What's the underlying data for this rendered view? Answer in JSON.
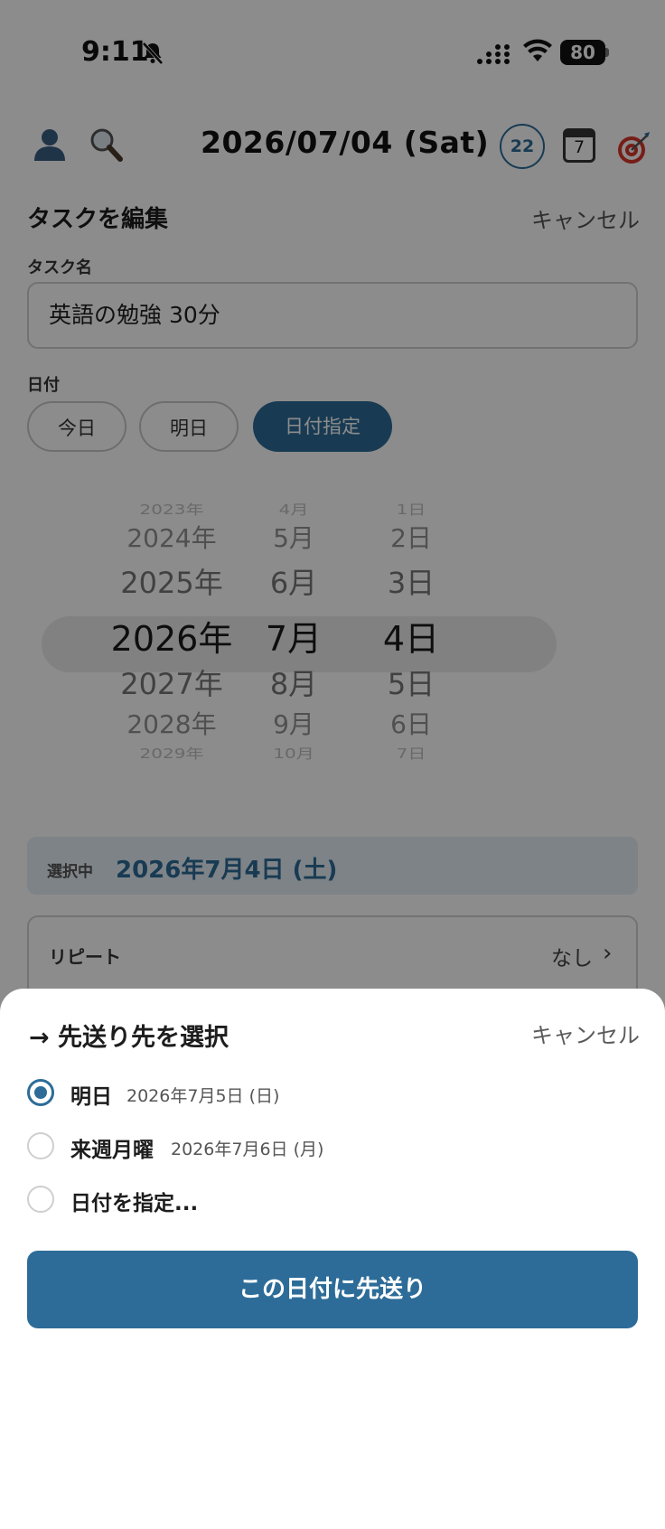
{
  "status_bar": {
    "time": "9:11",
    "battery": "80"
  },
  "header": {
    "date": "2026/07/04 (Sat)",
    "badge": "22",
    "calendar_day": "7"
  },
  "edit_sheet": {
    "title": "タスクを編集",
    "cancel": "キャンセル",
    "task_name_label": "タスク名",
    "task_name_value": "英語の勉強 30分",
    "date_label": "日付",
    "chips": [
      "今日",
      "明日",
      "日付指定"
    ],
    "picker": {
      "years": [
        "2023年",
        "2024年",
        "2025年",
        "2026年",
        "2027年",
        "2028年",
        "2029年"
      ],
      "months": [
        "4月",
        "5月",
        "6月",
        "7月",
        "8月",
        "9月",
        "10月"
      ],
      "days": [
        "1日",
        "2日",
        "3日",
        "4日",
        "5日",
        "6日",
        "7日"
      ],
      "selected_index": 3
    },
    "selected_label": "選択中",
    "selected_value": "2026年7月4日 (土)",
    "repeat_label": "リピート",
    "repeat_value": "なし",
    "repeat_chevron": "›"
  },
  "postpone_sheet": {
    "title": "→ 先送り先を選択",
    "cancel": "キャンセル",
    "options": [
      {
        "label": "明日",
        "date": "2026年7月5日 (日)",
        "selected": true
      },
      {
        "label": "来週月曜",
        "date": "2026年7月6日 (月)",
        "selected": false
      },
      {
        "label": "日付を指定...",
        "date": "",
        "selected": false
      }
    ],
    "confirm": "この日付に先送り"
  },
  "colors": {
    "accent": "#2d6c98",
    "selected_bg": "#e6eef6"
  }
}
